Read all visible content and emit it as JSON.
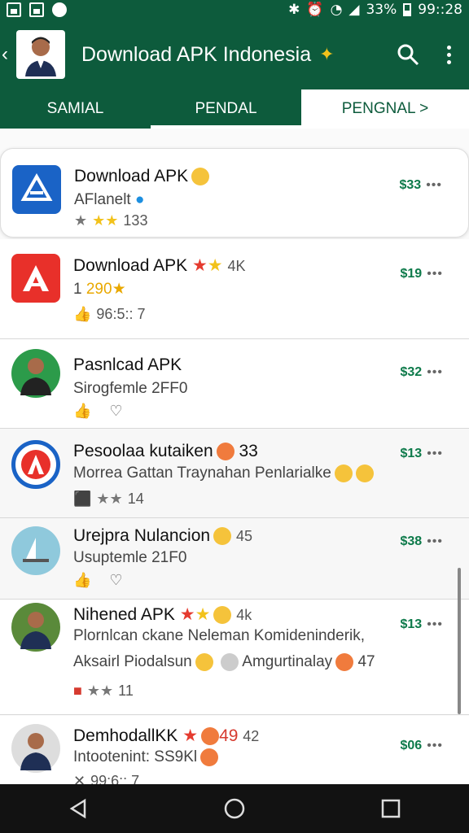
{
  "status": {
    "battery": "33%",
    "time": "99::28"
  },
  "header": {
    "title": "Download APK Indonesia",
    "search_icon": "search-icon",
    "menu_icon": "more-vert-icon"
  },
  "tabs": [
    {
      "label": "SAMIAL"
    },
    {
      "label": "PENDAL"
    },
    {
      "label": "PENGNAL >"
    }
  ],
  "apps": [
    {
      "name": "Download APK",
      "sub": "AFlanelt",
      "rating": "133",
      "price": "$33"
    },
    {
      "name": "Download APK",
      "badge": "4K",
      "sub_num": "1",
      "sub_val": "290",
      "meta": "96:5:: 7",
      "price": "$19"
    },
    {
      "name": "Pasnlcad APK",
      "sub": "Sirogfemle 2FF0",
      "price": "$32"
    },
    {
      "name": "Pesoolaa kutaiken",
      "badge": "33",
      "sub": "Morrea Gattan Traynahan Penlarialke",
      "rating": "14",
      "price": "$13"
    },
    {
      "name": "Urejpra Nulancion",
      "badge": "45",
      "sub": "Usuptemle 21F0",
      "price": "$38"
    },
    {
      "name": "Nihened APK",
      "badge": "4k",
      "sub": "Plornlcan ckane Neleman Komideninderik,",
      "sub2": "Aksairl Piodalsun",
      "sub3": "Amgurtinalay",
      "sub3_num": "47",
      "rating": "11",
      "price": "$13"
    },
    {
      "name": "DemhodallKK",
      "badge": "49",
      "badge2": "42",
      "sub": "Intootenint: SS9Kl",
      "meta": "99:6:: 7",
      "price": "$06"
    }
  ],
  "more_label": "•••",
  "colors": {
    "primary": "#0d5b3c",
    "price": "#0d7a4a"
  }
}
